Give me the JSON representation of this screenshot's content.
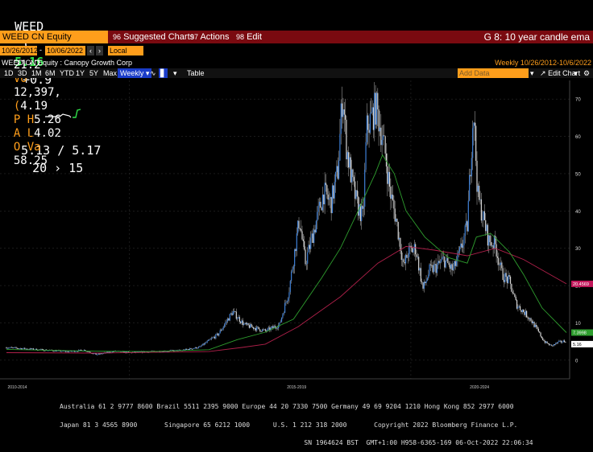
{
  "quote": {
    "ticker": "WEED",
    "flag": "C",
    "last_price": "5.16",
    "change": "+0.9",
    "bid_ask": "5.13 / 5.17",
    "size": "20 › 15",
    "at_label": "At",
    "at_time": "21:2",
    "volume_label": "Vo",
    "volume": "12,397,",
    "open_label": "(",
    "open": "4.19",
    "high_label": "P H",
    "high": "5.26",
    "low_label": "A L",
    "low": "4.02",
    "val_label": "O Va",
    "value": "58.25"
  },
  "menubar": {
    "security": "WEED CN Equity",
    "suggested": "Suggested Charts",
    "actions": "Actions",
    "edit": "Edit",
    "function_title": "G 8: 10 year candle ema"
  },
  "date_row": {
    "start_date": "10/26/2012",
    "end_date": "10/06/2022",
    "currency": "Local CCY"
  },
  "info_row": {
    "security_name": "WEED CN Equity : Canopy Growth Corp",
    "period_range": "Weekly  10/26/2012-10/6/2022"
  },
  "toolbar": {
    "periods": [
      "1D",
      "3D",
      "1M",
      "6M",
      "YTD",
      "1Y",
      "5Y",
      "Max"
    ],
    "frequency": "Weekly",
    "table": "Table",
    "add_data_placeholder": "Add Data",
    "edit_chart": "Edit Chart"
  },
  "chart_data": {
    "type": "candlestick",
    "frequency": "weekly",
    "x_labels": [
      "2010-2014",
      "2015-2019",
      "2020-2024"
    ],
    "y_ticks": [
      0,
      10,
      20,
      30,
      40,
      50,
      60,
      70
    ],
    "ylim": [
      -5,
      75
    ],
    "last_value_labels": [
      {
        "value": "20.4569",
        "color": "#c2185b"
      },
      {
        "value": "7.3998",
        "color": "#2e9d2e"
      },
      {
        "value": "5.16",
        "color": "#ffffff"
      }
    ],
    "price_series": [
      [
        "2012-10-26",
        3.4
      ],
      [
        "2013-06-01",
        2.8
      ],
      [
        "2013-12-01",
        2.3
      ],
      [
        "2014-03-15",
        2.7
      ],
      [
        "2014-06-01",
        1.5
      ],
      [
        "2014-10-01",
        2.4
      ],
      [
        "2015-01-01",
        2.0
      ],
      [
        "2015-06-01",
        2.3
      ],
      [
        "2015-12-01",
        2.6
      ],
      [
        "2016-04-01",
        3.5
      ],
      [
        "2016-08-01",
        7.0
      ],
      [
        "2016-11-01",
        13.0
      ],
      [
        "2017-01-15",
        9.5
      ],
      [
        "2017-06-01",
        7.8
      ],
      [
        "2017-09-01",
        9.5
      ],
      [
        "2017-11-01",
        18.5
      ],
      [
        "2018-01-08",
        38.0
      ],
      [
        "2018-02-15",
        26.0
      ],
      [
        "2018-04-01",
        33.0
      ],
      [
        "2018-06-15",
        45.0
      ],
      [
        "2018-08-01",
        42.0
      ],
      [
        "2018-09-15",
        51.0
      ],
      [
        "2018-10-15",
        72.0
      ],
      [
        "2018-11-10",
        57.0
      ],
      [
        "2018-12-15",
        48.0
      ],
      [
        "2019-01-15",
        42.0
      ],
      [
        "2019-02-25",
        38.0
      ],
      [
        "2019-03-20",
        62.0
      ],
      [
        "2019-04-20",
        65.0
      ],
      [
        "2019-05-20",
        68.0
      ],
      [
        "2019-06-20",
        62.0
      ],
      [
        "2019-07-20",
        55.0
      ],
      [
        "2019-08-20",
        45.0
      ],
      [
        "2019-10-01",
        37.0
      ],
      [
        "2019-11-15",
        25.0
      ],
      [
        "2019-12-15",
        29.0
      ],
      [
        "2020-02-01",
        30.0
      ],
      [
        "2020-03-20",
        19.0
      ],
      [
        "2020-05-01",
        24.0
      ],
      [
        "2020-06-15",
        25.0
      ],
      [
        "2020-08-01",
        27.0
      ],
      [
        "2020-10-01",
        24.0
      ],
      [
        "2020-11-15",
        29.0
      ],
      [
        "2021-01-01",
        36.0
      ],
      [
        "2021-02-10",
        68.0
      ],
      [
        "2021-03-10",
        44.0
      ],
      [
        "2021-04-15",
        38.0
      ],
      [
        "2021-05-20",
        32.0
      ],
      [
        "2021-07-01",
        31.0
      ],
      [
        "2021-08-15",
        23.0
      ],
      [
        "2021-10-01",
        21.0
      ],
      [
        "2021-11-15",
        15.0
      ],
      [
        "2022-01-01",
        13.0
      ],
      [
        "2022-02-15",
        11.0
      ],
      [
        "2022-04-01",
        8.0
      ],
      [
        "2022-05-15",
        5.0
      ],
      [
        "2022-07-01",
        3.8
      ],
      [
        "2022-08-15",
        4.8
      ],
      [
        "2022-10-06",
        5.16
      ]
    ],
    "ema_green": [
      [
        "2012-10-26",
        2.9
      ],
      [
        "2014-06-01",
        2.4
      ],
      [
        "2015-06-01",
        2.3
      ],
      [
        "2016-06-01",
        2.8
      ],
      [
        "2016-12-01",
        5.5
      ],
      [
        "2017-06-01",
        7.5
      ],
      [
        "2017-12-01",
        11.0
      ],
      [
        "2018-06-01",
        22.0
      ],
      [
        "2018-10-01",
        30.0
      ],
      [
        "2019-01-01",
        38.0
      ],
      [
        "2019-05-15",
        50.0
      ],
      [
        "2019-07-01",
        55.0
      ],
      [
        "2019-09-15",
        50.0
      ],
      [
        "2019-12-01",
        40.0
      ],
      [
        "2020-04-01",
        33.0
      ],
      [
        "2020-09-01",
        27.5
      ],
      [
        "2021-01-01",
        26.0
      ],
      [
        "2021-03-01",
        33.0
      ],
      [
        "2021-06-01",
        34.0
      ],
      [
        "2021-10-01",
        29.0
      ],
      [
        "2022-01-01",
        23.0
      ],
      [
        "2022-05-01",
        14.0
      ],
      [
        "2022-10-06",
        7.4
      ]
    ],
    "ema_red": [
      [
        "2012-10-26",
        2.0
      ],
      [
        "2014-06-01",
        1.9
      ],
      [
        "2015-06-01",
        2.1
      ],
      [
        "2016-06-01",
        2.3
      ],
      [
        "2017-01-01",
        3.4
      ],
      [
        "2017-06-01",
        4.3
      ],
      [
        "2018-01-01",
        9.0
      ],
      [
        "2018-10-01",
        17.0
      ],
      [
        "2019-06-01",
        26.0
      ],
      [
        "2019-12-01",
        30.5
      ],
      [
        "2020-06-01",
        29.5
      ],
      [
        "2021-01-01",
        28.0
      ],
      [
        "2021-07-01",
        30.0
      ],
      [
        "2022-01-01",
        27.0
      ],
      [
        "2022-10-06",
        20.46
      ]
    ]
  },
  "footer": {
    "line1": "Australia 61 2 9777 8600 Brazil 5511 2395 9000 Europe 44 20 7330 7500 Germany 49 69 9204 1210 Hong Kong 852 2977 6000",
    "line2": "Japan 81 3 4565 8900       Singapore 65 6212 1000      U.S. 1 212 318 2000       Copyright 2022 Bloomberg Finance L.P.",
    "line3": "                                                               SN 1964624 BST  GMT+1:00 H958-6365-169 06-Oct-2022 22:06:34"
  }
}
